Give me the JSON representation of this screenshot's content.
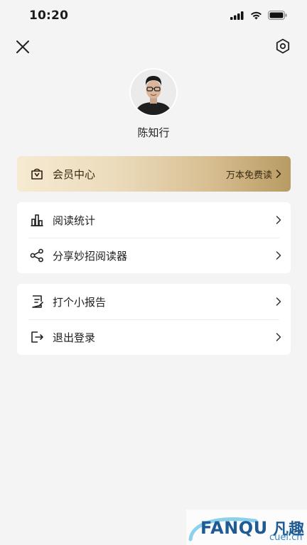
{
  "status_bar": {
    "time": "10:20"
  },
  "profile": {
    "name": "陈知行"
  },
  "vip": {
    "title": "会员中心",
    "subtitle": "万本免费读"
  },
  "menu_group_1": [
    {
      "label": "阅读统计",
      "icon": "bar-chart-icon"
    },
    {
      "label": "分享妙招阅读器",
      "icon": "share-icon"
    }
  ],
  "menu_group_2": [
    {
      "label": "打个小报告",
      "icon": "report-icon"
    },
    {
      "label": "退出登录",
      "icon": "logout-icon"
    }
  ],
  "watermark": {
    "brand": "FANQU",
    "cn": "凡趣",
    "url": "cuel.cn"
  },
  "colors": {
    "background": "#f4f4f4",
    "card": "#ffffff",
    "vip_gold": "#b89b63",
    "vip_light": "#f6ead2"
  }
}
